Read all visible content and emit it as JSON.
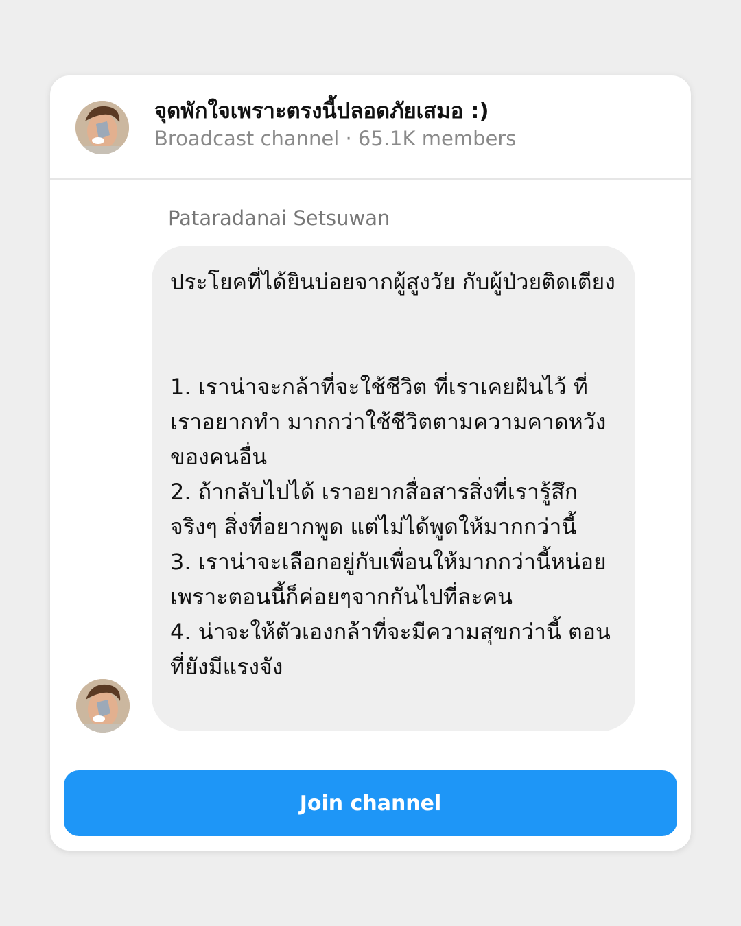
{
  "channel": {
    "title": "จุดพักใจเพราะตรงนี้ปลอดภัยเสมอ :)",
    "subtitle": "Broadcast channel · 65.1K members",
    "avatar_icon": "profile-photo"
  },
  "message": {
    "sender": "Pataradanai Setsuwan",
    "intro": "ประโยคที่ได้ยินบ่อยจากผู้สูงวัย กับผู้ป่วยติดเตียง",
    "items": [
      "1. เราน่าจะกล้าที่จะใช้ชีวิต ที่เราเคยฝันไว้ ที่เราอยากทำ มากกว่าใช้ชีวิตตามความคาดหวังของคนอื่น",
      "2. ถ้ากลับไปได้ เราอยากสื่อสารสิ่งที่เรารู้สึกจริงๆ สิ่งที่อยากพูด แต่ไม่ได้พูดให้มากกว่านี้",
      "3. เราน่าจะเลือกอยู่กับเพื่อนให้มากกว่านี้หน่อย เพราะตอนนี้ก็ค่อยๆจากกันไปที่ละคน",
      "4. น่าจะให้ตัวเองกล้าที่จะมีความสุขกว่านี้ ตอนที่ยังมีแรงจัง"
    ]
  },
  "actions": {
    "join_label": "Join channel"
  },
  "colors": {
    "accent": "#1e96f7",
    "bubble": "#efefef",
    "background": "#eeeeee"
  }
}
